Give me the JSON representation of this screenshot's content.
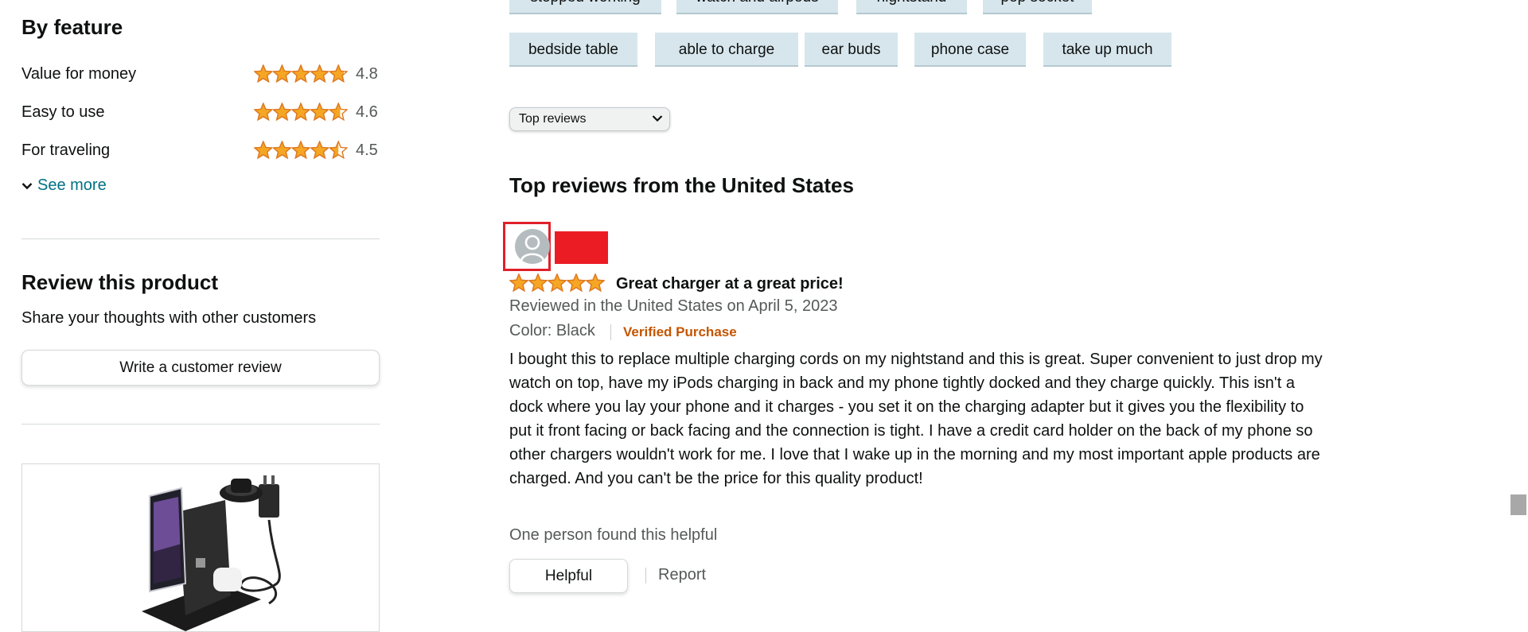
{
  "by_feature": {
    "heading": "By feature",
    "items": [
      {
        "label": "Value for money",
        "rating": 4.8,
        "value_text": "4.8"
      },
      {
        "label": "Easy to use",
        "rating": 4.6,
        "value_text": "4.6"
      },
      {
        "label": "For traveling",
        "rating": 4.5,
        "value_text": "4.5"
      }
    ],
    "see_more": "See more"
  },
  "review_product": {
    "heading": "Review this product",
    "subtext": "Share your thoughts with other customers",
    "button": "Write a customer review"
  },
  "keyword_pills": {
    "row1": [
      "stopped working",
      "watch and airpods",
      "nightstand",
      "pop socket"
    ],
    "row2": [
      "bedside table",
      "able to charge",
      "ear buds",
      "phone case",
      "take up much"
    ]
  },
  "sort": {
    "selected": "Top reviews"
  },
  "reviews_section": {
    "heading": "Top reviews from the United States"
  },
  "review": {
    "rating": 5,
    "title": "Great charger at a great price!",
    "date_line": "Reviewed in the United States on April 5, 2023",
    "color": "Color: Black",
    "verified": "Verified Purchase",
    "body": "I bought this to replace multiple charging cords on my nightstand and this is great. Super convenient to just drop my watch on top, have my iPods charging in back and my phone tightly docked and they charge quickly. This isn't a dock where you lay your phone and it charges - you set it on the charging adapter but it gives you the flexibility to put it front facing or back facing and the connection is tight. I have a credit card holder on the back of my phone so other chargers wouldn't work for me. I love that I wake up in the morning and my most important apple products are charged. And you can't be the price for this quality product!",
    "helpful_text": "One person found this helpful",
    "helpful_button": "Helpful",
    "report": "Report"
  },
  "colors": {
    "star": "#f5a623",
    "star_outline": "#de7921",
    "link": "#007185",
    "verified": "#c45500",
    "pill_bg": "#d6e6ec",
    "redaction": "#ec1c24"
  },
  "icons": [
    "chevron-down-icon",
    "star-icon",
    "user-avatar-icon"
  ]
}
